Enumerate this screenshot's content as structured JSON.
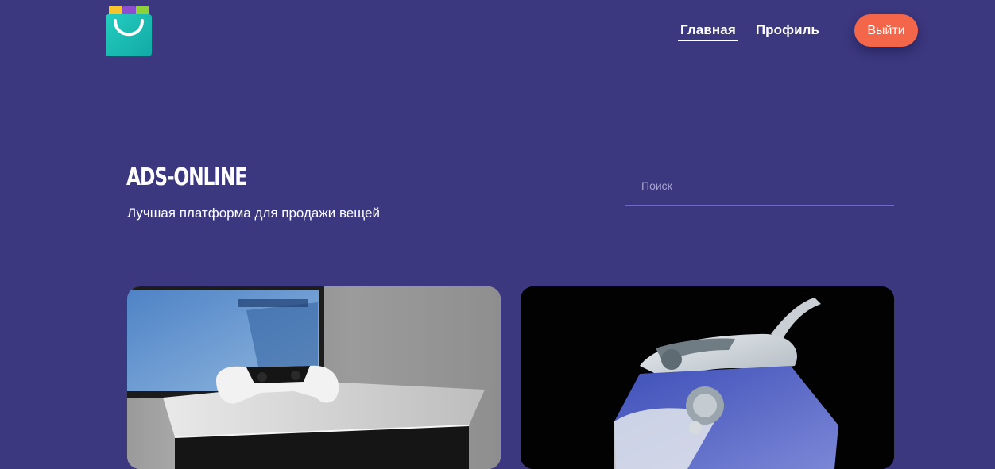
{
  "header": {
    "logo_name": "shopping-bag-logo",
    "nav": [
      {
        "label": "Главная",
        "active": true
      },
      {
        "label": "Профиль",
        "active": false
      }
    ],
    "logout_label": "Выйти"
  },
  "hero": {
    "title": "ADS-ONLINE",
    "subtitle": "Лучшая платформа для продажи вещей"
  },
  "search": {
    "placeholder": "Поиск",
    "value": ""
  },
  "ads": [
    {
      "image": "game-console-with-controller"
    },
    {
      "image": "steam-iron"
    }
  ],
  "colors": {
    "background": "#3b387f",
    "accent": "#f4664a",
    "search_underline": "#6e6acb",
    "logo_bag": "#1bbfb4"
  }
}
